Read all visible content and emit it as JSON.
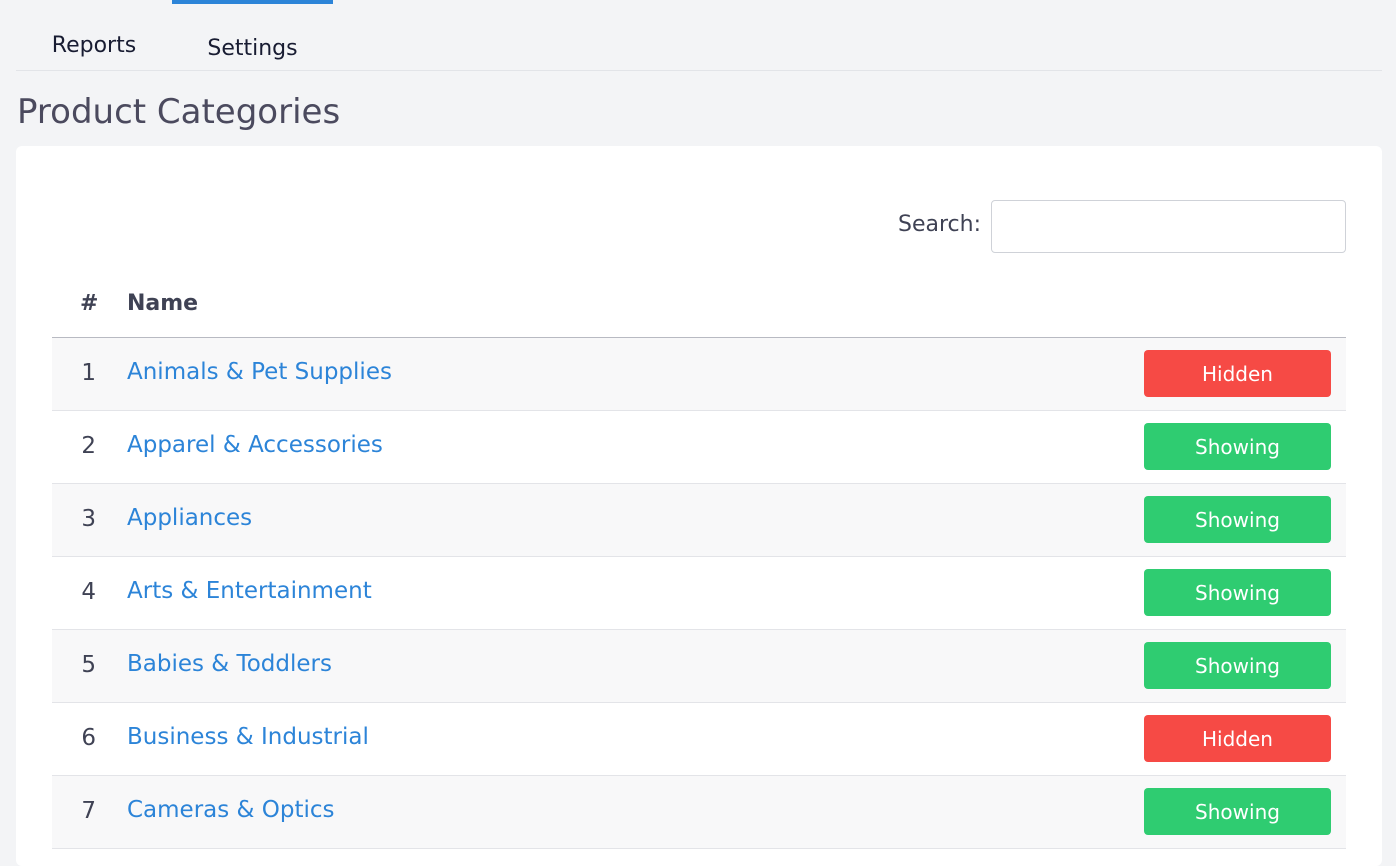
{
  "tabs": [
    {
      "label": "Reports",
      "active": false
    },
    {
      "label": "Settings",
      "active": true
    }
  ],
  "page": {
    "title": "Product Categories"
  },
  "search": {
    "label": "Search:",
    "value": "",
    "placeholder": ""
  },
  "table": {
    "columns": [
      "#",
      "Name"
    ],
    "rows": [
      {
        "num": "1",
        "name": "Animals & Pet Supplies",
        "status": "Hidden"
      },
      {
        "num": "2",
        "name": "Apparel & Accessories",
        "status": "Showing"
      },
      {
        "num": "3",
        "name": "Appliances",
        "status": "Showing"
      },
      {
        "num": "4",
        "name": "Arts & Entertainment",
        "status": "Showing"
      },
      {
        "num": "5",
        "name": "Babies & Toddlers",
        "status": "Showing"
      },
      {
        "num": "6",
        "name": "Business & Industrial",
        "status": "Hidden"
      },
      {
        "num": "7",
        "name": "Cameras & Optics",
        "status": "Showing"
      }
    ]
  },
  "colors": {
    "accent": "#2c84d8",
    "hidden": "#f64a45",
    "showing": "#2fcc71"
  }
}
